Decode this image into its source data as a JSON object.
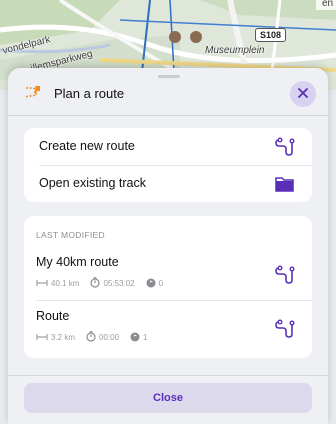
{
  "map": {
    "labels": [
      "vondelpark",
      "illemsparkweg",
      "Museumplein",
      "en"
    ],
    "road_badge": "S108"
  },
  "header": {
    "title": "Plan a route",
    "icon": "plan-route-icon",
    "close_icon": "close-icon"
  },
  "actions": [
    {
      "label": "Create new route",
      "icon": "route-icon"
    },
    {
      "label": "Open existing track",
      "icon": "folder-icon"
    }
  ],
  "recent": {
    "section_title": "LAST MODIFIED",
    "items": [
      {
        "name": "My 40km route",
        "distance": "40.1 km",
        "duration": "05:53:02",
        "waypoints": "0",
        "icon": "route-icon"
      },
      {
        "name": "Route",
        "distance": "3.2 km",
        "duration": "00:00",
        "waypoints": "1",
        "icon": "route-icon"
      }
    ]
  },
  "footer": {
    "close_label": "Close"
  },
  "colors": {
    "accent": "#5a2fb8",
    "header_icon": "#f08c1e",
    "sheet_bg": "#eef0f4"
  }
}
